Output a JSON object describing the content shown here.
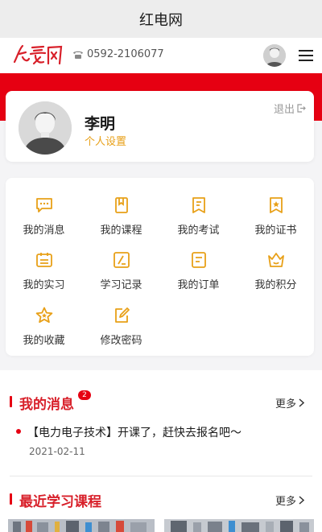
{
  "app": {
    "title": "红电网"
  },
  "header": {
    "logo_text": "红电网",
    "phone": "0592-2106077",
    "phone_icon": "phone-icon",
    "menu_icon": "menu-icon"
  },
  "profile": {
    "name": "李明",
    "settings_label": "个人设置",
    "logout_label": "退出"
  },
  "menu": {
    "items": [
      {
        "label": "我的消息",
        "icon": "message-icon"
      },
      {
        "label": "我的课程",
        "icon": "course-icon"
      },
      {
        "label": "我的考试",
        "icon": "exam-icon"
      },
      {
        "label": "我的证书",
        "icon": "certificate-icon"
      },
      {
        "label": "我的实习",
        "icon": "internship-icon"
      },
      {
        "label": "学习记录",
        "icon": "study-record-icon"
      },
      {
        "label": "我的订单",
        "icon": "order-icon"
      },
      {
        "label": "我的积分",
        "icon": "points-icon"
      },
      {
        "label": "我的收藏",
        "icon": "favorite-icon"
      },
      {
        "label": "修改密码",
        "icon": "edit-password-icon"
      }
    ]
  },
  "messages_section": {
    "title": "我的消息",
    "badge": "2",
    "more_label": "更多",
    "items": [
      {
        "title": "【电力电子技术】开课了，赶快去报名吧～",
        "date": "2021-02-11"
      }
    ]
  },
  "courses_section": {
    "title": "最近学习课程",
    "more_label": "更多"
  },
  "colors": {
    "brand_red": "#e60012",
    "accent_orange": "#e8a018"
  }
}
